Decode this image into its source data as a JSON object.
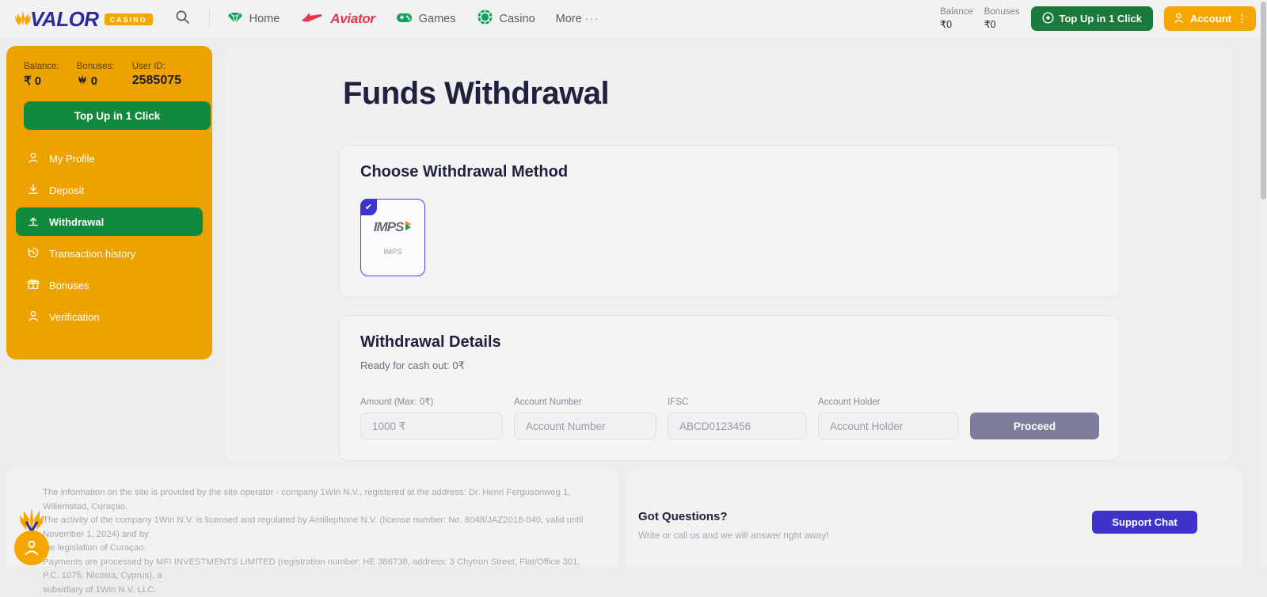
{
  "topbar": {
    "logo_name": "VALOR",
    "logo_badge": "CASINO",
    "search_icon": "search-icon",
    "nav": [
      {
        "label": "Home",
        "icon": "gem-icon"
      },
      {
        "label": "Aviator",
        "icon": "plane-icon"
      },
      {
        "label": "Games",
        "icon": "gamepad-icon"
      },
      {
        "label": "Casino",
        "icon": "poker-chip-icon"
      }
    ],
    "more_label": "More",
    "more_dots": "···",
    "balance_label": "Balance",
    "balance_value": "₹0",
    "bonuses_label": "Bonuses",
    "bonuses_value": "₹0",
    "topup_label": "Top Up in 1 Click",
    "account_label": "Account",
    "account_kebab": "⋮"
  },
  "sidebar": {
    "balance_label": "Balance:",
    "balance_value": "₹ 0",
    "bonuses_label": "Bonuses:",
    "bonuses_value": "0",
    "userid_label": "User ID:",
    "userid_value": "2585075",
    "topup_label": "Top Up in 1 Click",
    "items": [
      {
        "label": "My Profile",
        "icon": "user-icon",
        "active": false
      },
      {
        "label": "Deposit",
        "icon": "download-icon",
        "active": false
      },
      {
        "label": "Withdrawal",
        "icon": "withdraw-arrow-icon",
        "active": true
      },
      {
        "label": "Transaction history",
        "icon": "history-icon",
        "active": false
      },
      {
        "label": "Bonuses",
        "icon": "gift-icon",
        "active": false
      },
      {
        "label": "Verification",
        "icon": "user-check-icon",
        "active": false
      }
    ]
  },
  "main": {
    "page_title": "Funds Withdrawal",
    "methods_card": {
      "title": "Choose Withdrawal Method",
      "method": {
        "logo_text": "IMPS",
        "label": "IMPS",
        "selected": true,
        "check_glyph": "✔"
      }
    },
    "details_card": {
      "title": "Withdrawal Details",
      "subtitle": "Ready for cash out: 0₹",
      "fields": [
        {
          "label": "Amount (Max: 0₹)",
          "placeholder": "1000 ₹",
          "value": ""
        },
        {
          "label": "Account Number",
          "placeholder": "Account Number",
          "value": ""
        },
        {
          "label": "IFSC",
          "placeholder": "ABCD0123456",
          "value": ""
        },
        {
          "label": "Account Holder",
          "placeholder": "Account Holder",
          "value": ""
        }
      ],
      "proceed_label": "Proceed"
    }
  },
  "footer": {
    "legal_line1": "The information on the site is provided by the site operator - company 1Win N.V., registered at the address: Dr. Henri Fergusonweg 1, Willemstad, Curaçao.",
    "legal_line2": "The activity of the company 1Win N.V. is licensed and regulated by Antillephone N.V. (license number: No. 8048/JAZ2018-040, valid until November 1, 2024) and by",
    "legal_line3": "the legislation of Curaçao.",
    "legal_line4": "Payments are processed by MFI INVESTMENTS LIMITED (registration number: HE 386738, address: 3 Chytron Street, Flat/Office 301, P.C. 1075, Nicosia, Cyprus), a",
    "legal_line5": "subsidiary of 1Win N.V. LLC.",
    "questions_title": "Got Questions?",
    "questions_sub": "Write or call us and we will answer right away!",
    "support_label": "Support Chat"
  },
  "colors": {
    "brand_orange": "#eda200",
    "brand_green": "#128a3e",
    "brand_indigo": "#3f34c9",
    "heading_navy": "#20203f",
    "page_bg": "#ececec"
  }
}
